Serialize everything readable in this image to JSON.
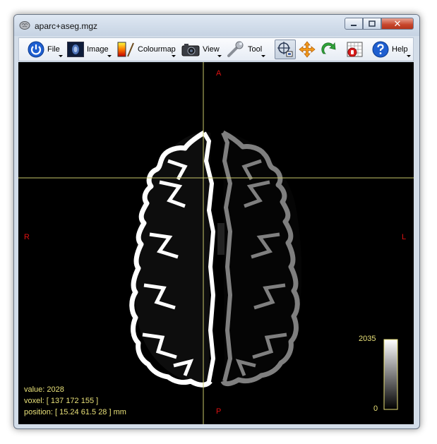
{
  "window": {
    "title": "aparc+aseg.mgz",
    "controls": {
      "close_glyph": "✕"
    }
  },
  "toolbar": {
    "file_label": "File",
    "image_label": "Image",
    "colourmap_label": "Colourmap",
    "view_label": "View",
    "tool_label": "Tool",
    "help_label": "Help"
  },
  "viewport": {
    "orientation": {
      "anterior": "A",
      "posterior": "P",
      "right": "R",
      "left": "L"
    },
    "value_text": "value: 2028",
    "voxel_text": "voxel: [ 137 172 155 ]",
    "position_text": "position: [ 15.24 61.5 28 ] mm",
    "colorbar": {
      "max_label": "2035",
      "min_label": "0"
    }
  },
  "colors": {
    "crosshair": "#c9c86a",
    "orientation_labels": "#dd1111",
    "info_text": "#e8e078",
    "right_hemisphere": "#ffffff",
    "left_hemisphere": "#7f7f7f",
    "background": "#000000"
  }
}
